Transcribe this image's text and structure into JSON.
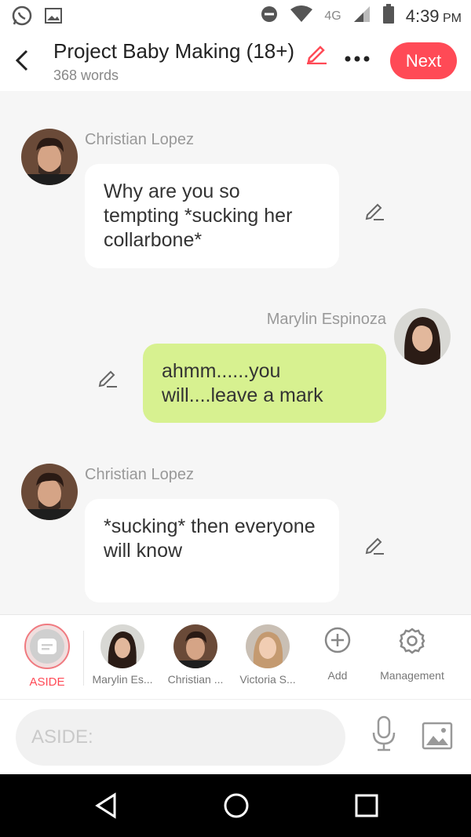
{
  "status_bar": {
    "network": "4G",
    "time": "4:39",
    "ampm": "PM"
  },
  "header": {
    "title": "Project Baby Making (18+)",
    "word_count": "368 words",
    "next_label": "Next"
  },
  "messages": [
    {
      "sender": "Christian Lopez",
      "text": "Why are you so tempting *sucking her collarbone*",
      "side": "left"
    },
    {
      "sender": "Marylin Espinoza",
      "text": "ahmm......you will....leave a mark",
      "side": "right"
    },
    {
      "sender": "Christian Lopez",
      "text": "*sucking* then everyone will know",
      "side": "left"
    }
  ],
  "toolbar": {
    "aside_label": "ASIDE",
    "characters": [
      {
        "label": "Marylin Es..."
      },
      {
        "label": "Christian ..."
      },
      {
        "label": "Victoria S..."
      }
    ],
    "add_label": "Add",
    "management_label": "Management"
  },
  "input": {
    "placeholder": "ASIDE:",
    "value": ""
  },
  "colors": {
    "accent": "#ff4a56",
    "bubble_right": "#d7f190",
    "bubble_left": "#ffffff"
  }
}
